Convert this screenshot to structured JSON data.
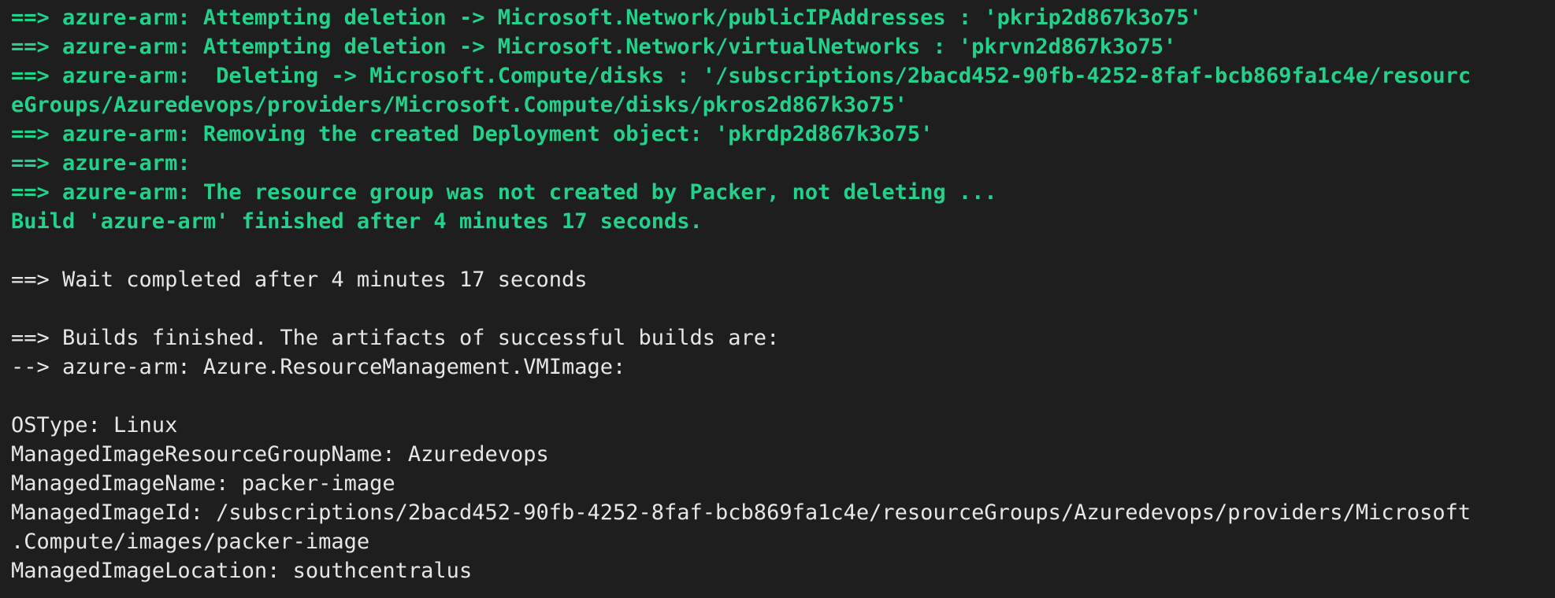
{
  "terminal": {
    "lines": [
      {
        "text": "==> azure-arm: Attempting deletion -> Microsoft.Network/publicIPAddresses : 'pkrip2d867k3o75'",
        "style": "green",
        "bold": true
      },
      {
        "text": "==> azure-arm: Attempting deletion -> Microsoft.Network/virtualNetworks : 'pkrvn2d867k3o75'",
        "style": "green",
        "bold": true
      },
      {
        "text": "==> azure-arm:  Deleting -> Microsoft.Compute/disks : '/subscriptions/2bacd452-90fb-4252-8faf-bcb869fa1c4e/resourc",
        "style": "green",
        "bold": true
      },
      {
        "text": "eGroups/Azuredevops/providers/Microsoft.Compute/disks/pkros2d867k3o75'",
        "style": "green",
        "bold": true
      },
      {
        "text": "==> azure-arm: Removing the created Deployment object: 'pkrdp2d867k3o75'",
        "style": "green",
        "bold": true
      },
      {
        "text": "==> azure-arm:",
        "style": "green",
        "bold": true
      },
      {
        "text": "==> azure-arm: The resource group was not created by Packer, not deleting ...",
        "style": "green",
        "bold": true
      },
      {
        "text": "Build 'azure-arm' finished after 4 minutes 17 seconds.",
        "style": "green",
        "bold": true
      },
      {
        "text": "",
        "style": "blank",
        "bold": false
      },
      {
        "text": "==> Wait completed after 4 minutes 17 seconds",
        "style": "white",
        "bold": false
      },
      {
        "text": "",
        "style": "blank",
        "bold": false
      },
      {
        "text": "==> Builds finished. The artifacts of successful builds are:",
        "style": "white",
        "bold": false
      },
      {
        "text": "--> azure-arm: Azure.ResourceManagement.VMImage:",
        "style": "white",
        "bold": false
      },
      {
        "text": "",
        "style": "blank",
        "bold": false
      },
      {
        "text": "OSType: Linux",
        "style": "white",
        "bold": false
      },
      {
        "text": "ManagedImageResourceGroupName: Azuredevops",
        "style": "white",
        "bold": false
      },
      {
        "text": "ManagedImageName: packer-image",
        "style": "white",
        "bold": false
      },
      {
        "text": "ManagedImageId: /subscriptions/2bacd452-90fb-4252-8faf-bcb869fa1c4e/resourceGroups/Azuredevops/providers/Microsoft",
        "style": "white",
        "bold": false
      },
      {
        "text": ".Compute/images/packer-image",
        "style": "white",
        "bold": false
      },
      {
        "text": "ManagedImageLocation: southcentralus",
        "style": "white",
        "bold": false
      }
    ]
  },
  "colors": {
    "background": "#1e1e1e",
    "green": "#23d18b",
    "white": "#e6e6e6"
  }
}
